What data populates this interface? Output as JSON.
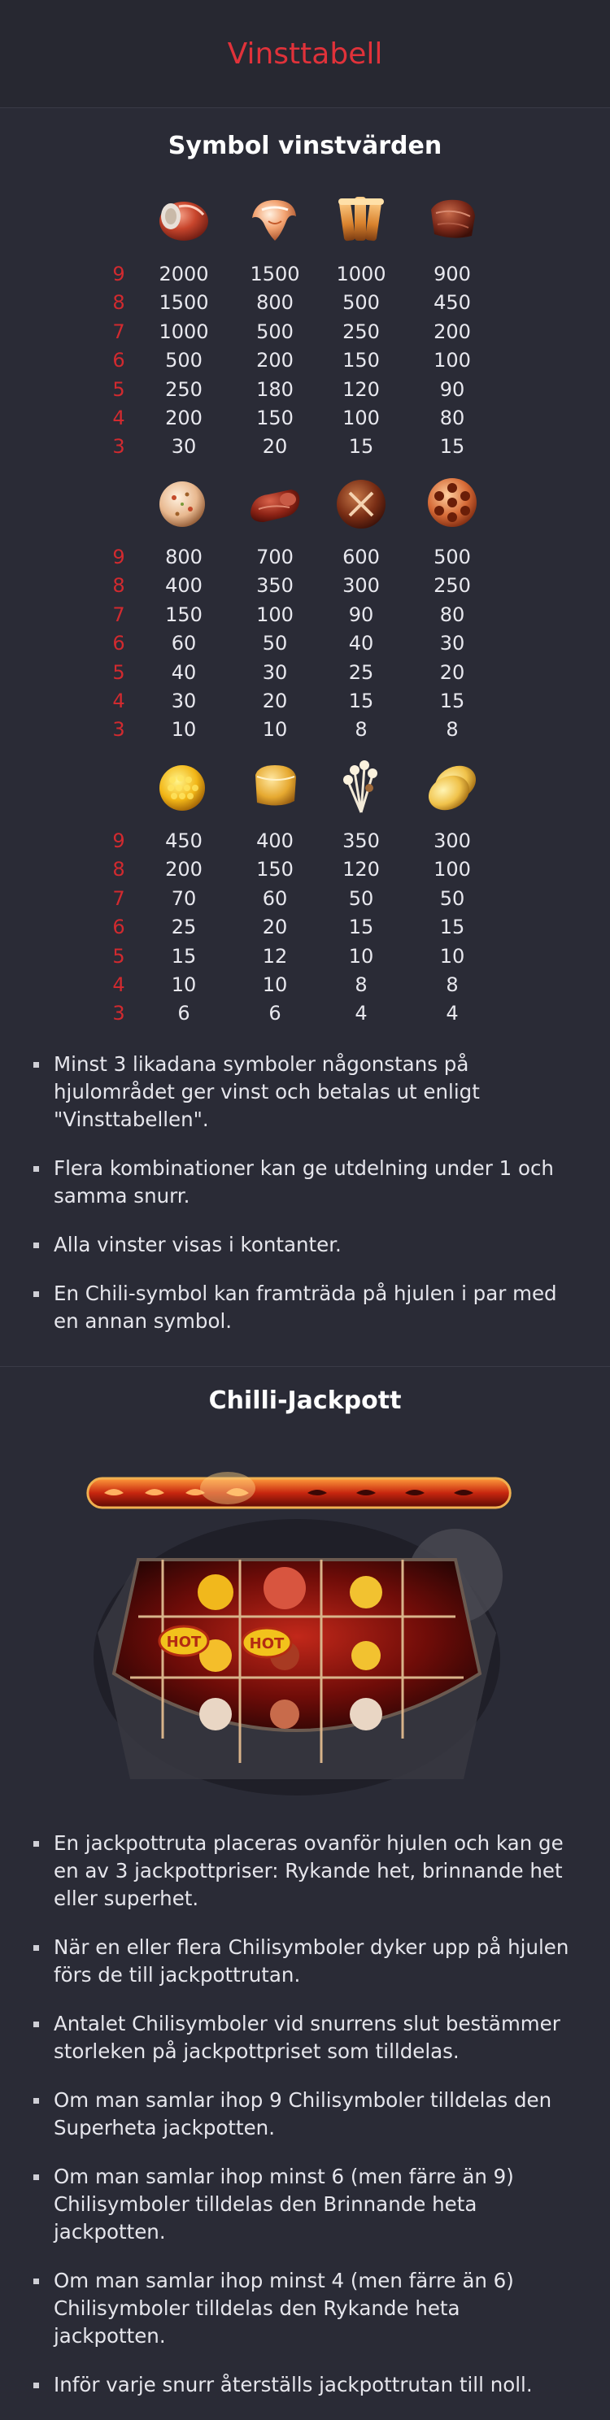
{
  "header": {
    "title": "Vinsttabell"
  },
  "symbols_section": {
    "title": "Symbol vinstvärden",
    "groups": [
      {
        "icons": [
          "ham-icon",
          "shrimp-dumpling-icon",
          "spring-roll-icon",
          "beef-slice-icon"
        ],
        "rows": [
          {
            "count": "9",
            "values": [
              "2000",
              "1500",
              "1000",
              "900"
            ]
          },
          {
            "count": "8",
            "values": [
              "1500",
              "800",
              "500",
              "450"
            ]
          },
          {
            "count": "7",
            "values": [
              "1000",
              "500",
              "250",
              "200"
            ]
          },
          {
            "count": "6",
            "values": [
              "500",
              "200",
              "150",
              "100"
            ]
          },
          {
            "count": "5",
            "values": [
              "250",
              "180",
              "120",
              "90"
            ]
          },
          {
            "count": "4",
            "values": [
              "200",
              "150",
              "100",
              "80"
            ]
          },
          {
            "count": "3",
            "values": [
              "30",
              "20",
              "15",
              "15"
            ]
          }
        ]
      },
      {
        "icons": [
          "meatball-icon",
          "sausage-icon",
          "mushroom-cap-icon",
          "lotus-root-icon"
        ],
        "rows": [
          {
            "count": "9",
            "values": [
              "800",
              "700",
              "600",
              "500"
            ]
          },
          {
            "count": "8",
            "values": [
              "400",
              "350",
              "300",
              "250"
            ]
          },
          {
            "count": "7",
            "values": [
              "150",
              "100",
              "90",
              "80"
            ]
          },
          {
            "count": "6",
            "values": [
              "60",
              "50",
              "40",
              "30"
            ]
          },
          {
            "count": "5",
            "values": [
              "40",
              "30",
              "25",
              "20"
            ]
          },
          {
            "count": "4",
            "values": [
              "30",
              "20",
              "15",
              "15"
            ]
          },
          {
            "count": "3",
            "values": [
              "10",
              "10",
              "8",
              "8"
            ]
          }
        ]
      },
      {
        "icons": [
          "corn-icon",
          "tofu-icon",
          "enoki-mushroom-icon",
          "potato-slice-icon"
        ],
        "rows": [
          {
            "count": "9",
            "values": [
              "450",
              "400",
              "350",
              "300"
            ]
          },
          {
            "count": "8",
            "values": [
              "200",
              "150",
              "120",
              "100"
            ]
          },
          {
            "count": "7",
            "values": [
              "70",
              "60",
              "50",
              "50"
            ]
          },
          {
            "count": "6",
            "values": [
              "25",
              "20",
              "15",
              "15"
            ]
          },
          {
            "count": "5",
            "values": [
              "15",
              "12",
              "10",
              "10"
            ]
          },
          {
            "count": "4",
            "values": [
              "10",
              "10",
              "8",
              "8"
            ]
          },
          {
            "count": "3",
            "values": [
              "6",
              "6",
              "4",
              "4"
            ]
          }
        ]
      }
    ],
    "rules": [
      "Minst 3  likadana symboler någonstans på hjulområdet ger vinst och betalas ut enligt \"Vinsttabellen\".",
      "Flera kombinationer kan ge utdelning under 1 och samma snurr.",
      "Alla vinster visas i kontanter.",
      "En Chili-symbol kan framträda på hjulen i par med en annan symbol."
    ]
  },
  "jackpot_section": {
    "title": "Chilli-Jackpott",
    "image_badges": [
      "HOT",
      "HOT"
    ],
    "rules": [
      "En jackpottruta placeras ovanför hjulen och kan ge en av 3 jackpottpriser: Rykande het, brinnande het eller superhet.",
      "När en eller flera Chilisymboler dyker upp på hjulen förs de till jackpottrutan.",
      "Antalet Chilisymboler vid snurrens slut bestämmer storleken på jackpottpriset som tilldelas.",
      "Om man samlar ihop 9 Chilisymboler tilldelas den Superheta jackpotten.",
      "Om man samlar ihop minst 6 (men färre än 9) Chilisymboler tilldelas den Brinnande heta jackpotten.",
      "Om man samlar ihop minst 4 (men färre än 6) Chilisymboler tilldelas den Rykande heta jackpotten.",
      "Inför varje snurr återställs jackpottrutan till noll."
    ]
  },
  "colors": {
    "background": "#2a2b36",
    "header": "#272831",
    "accent": "#e0323a",
    "count": "#d12a2f"
  }
}
